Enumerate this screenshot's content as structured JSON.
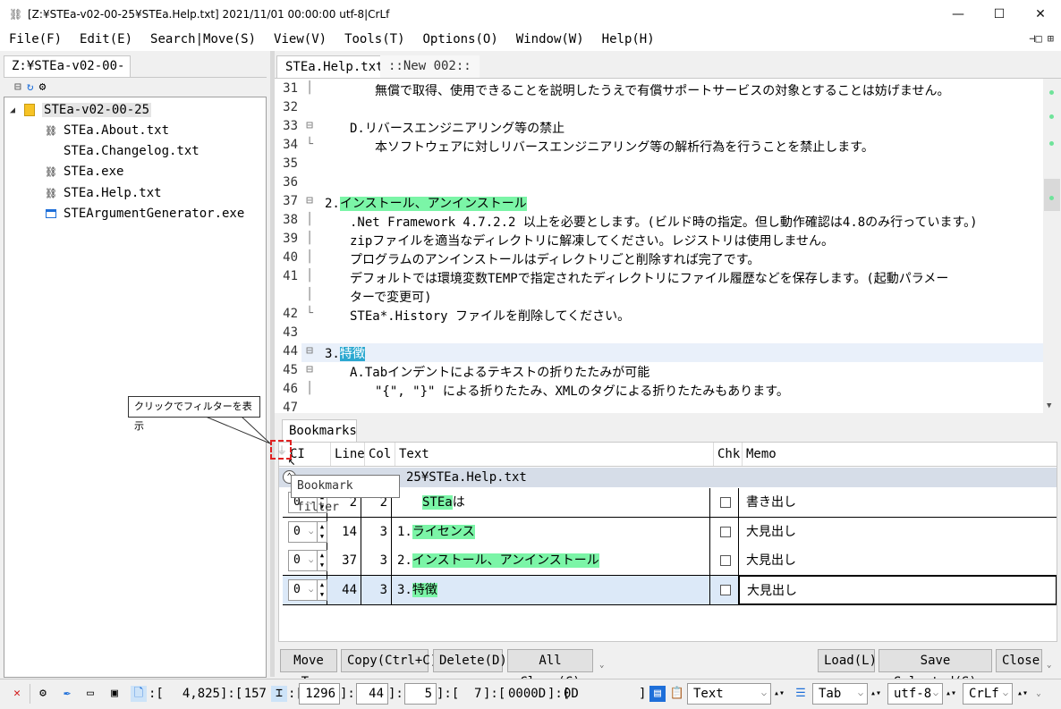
{
  "window": {
    "title": "[Z:¥STEa-v02-00-25¥STEa.Help.txt] 2021/11/01 00:00:00 utf-8|CrLf",
    "minimize": "—",
    "maximize": "☐",
    "close": "✕"
  },
  "menu": [
    {
      "label": "File(F)"
    },
    {
      "label": "Edit(E)"
    },
    {
      "label": "Search|Move(S)"
    },
    {
      "label": "View(V)"
    },
    {
      "label": "Tools(T)"
    },
    {
      "label": "Options(O)"
    },
    {
      "label": "Window(W)"
    },
    {
      "label": "Help(H)"
    }
  ],
  "explorer": {
    "tab": "Z:¥STEa-v02-00-25",
    "root": "STEa-v02-00-25",
    "files": [
      {
        "name": "STEa.About.txt",
        "icon": "stea-file-icon"
      },
      {
        "name": "STEa.Changelog.txt",
        "icon": "none"
      },
      {
        "name": "STEa.exe",
        "icon": "stea-file-icon"
      },
      {
        "name": "STEa.Help.txt",
        "icon": "stea-file-icon"
      },
      {
        "name": "STEArgumentGenerator.exe",
        "icon": "exe-window-icon"
      }
    ]
  },
  "editor": {
    "tabs": [
      "STEa.Help.txt",
      "::New 002::"
    ],
    "lines": [
      {
        "num": "31",
        "fold": "│",
        "pre": "　　　　",
        "hl": "",
        "post": "無償で取得、使用できることを説明したうえで有償サポートサービスの対象とすることは妨げません。",
        "style": ""
      },
      {
        "num": "32",
        "fold": "",
        "pre": "",
        "hl": "",
        "post": "",
        "style": ""
      },
      {
        "num": "33",
        "fold": "⊟",
        "pre": "　　",
        "hl": "",
        "post": "D.リバースエンジニアリング等の禁止",
        "style": ""
      },
      {
        "num": "34",
        "fold": "└",
        "pre": "　　　　",
        "hl": "",
        "post": "本ソフトウェアに対しリバースエンジニアリング等の解析行為を行うことを禁止します。",
        "style": ""
      },
      {
        "num": "35",
        "fold": "",
        "pre": "",
        "hl": "",
        "post": "",
        "style": ""
      },
      {
        "num": "36",
        "fold": "",
        "pre": "",
        "hl": "",
        "post": "",
        "style": ""
      },
      {
        "num": "37",
        "fold": "⊟",
        "pre": "2.",
        "hl": "インストール、アンインストール",
        "post": "",
        "style": "green"
      },
      {
        "num": "38",
        "fold": "│",
        "pre": "　　",
        "hl": "",
        "post": ".Net Framework 4.7.2.2 以上を必要とします。(ビルド時の指定。但し動作確認は4.8のみ行っています。)",
        "style": ""
      },
      {
        "num": "39",
        "fold": "│",
        "pre": "　　",
        "hl": "",
        "post": "zipファイルを適当なディレクトリに解凍してください。レジストリは使用しません。",
        "style": ""
      },
      {
        "num": "40",
        "fold": "│",
        "pre": "　　",
        "hl": "",
        "post": "プログラムのアンインストールはディレクトリごと削除すれば完了です。",
        "style": ""
      },
      {
        "num": "41",
        "fold": "│",
        "pre": "　　",
        "hl": "",
        "post": "デフォルトでは環境変数TEMPで指定されたディレクトリにファイル履歴などを保存します。(起動パラメー",
        "style": ""
      },
      {
        "num": "",
        "fold": "│",
        "pre": "　　",
        "hl": "",
        "post": "ターで変更可)",
        "style": ""
      },
      {
        "num": "42",
        "fold": "└",
        "pre": "　　",
        "hl": "",
        "post": "STEa*.History ファイルを削除してください。",
        "style": ""
      },
      {
        "num": "43",
        "fold": "",
        "pre": "",
        "hl": "",
        "post": "",
        "style": ""
      },
      {
        "num": "44",
        "fold": "⊟",
        "pre": "3.",
        "hl": "特徴",
        "post": "",
        "style": "teal"
      },
      {
        "num": "45",
        "fold": "⊟",
        "pre": "　　",
        "hl": "",
        "post": "A.Tabインデントによるテキストの折りたたみが可能",
        "style": ""
      },
      {
        "num": "46",
        "fold": "│",
        "pre": "　　　　",
        "hl": "",
        "post": "\"{\", \"}\" による折りたたみ、XMLのタグによる折りたたみもあります。",
        "style": ""
      },
      {
        "num": "47",
        "fold": "",
        "pre": "",
        "hl": "",
        "post": "",
        "style": ""
      }
    ]
  },
  "bookmarks": {
    "tab": "Bookmarks",
    "headers": {
      "cl": "CI",
      "line": "Line",
      "col": "Col",
      "text": "Text",
      "chk": "Chk",
      "memo": "Memo"
    },
    "group": "25¥STEa.Help.txt",
    "rows": [
      {
        "cl": "0",
        "line": "2",
        "col": "2",
        "prefix": "　　",
        "text": "STEaは",
        "hl": "STEa",
        "rest": "は",
        "memo": "書き出し",
        "selected": false
      },
      {
        "cl": "0",
        "line": "14",
        "col": "3",
        "prefix": "1.",
        "hl": "ライセンス",
        "rest": "",
        "memo": "大見出し",
        "selected": false
      },
      {
        "cl": "0",
        "line": "37",
        "col": "3",
        "prefix": "2.",
        "hl": "インストール、アンインストール",
        "rest": "",
        "memo": "大見出し",
        "selected": false
      },
      {
        "cl": "0",
        "line": "44",
        "col": "3",
        "prefix": "3.",
        "hl": "特徴",
        "rest": "",
        "memo": "大見出し",
        "selected": true
      }
    ],
    "buttons": {
      "move_to": "Move To",
      "copy": "Copy(Ctrl+C)",
      "delete": "Delete(D)",
      "all_clear": "All Clear(C)",
      "load": "Load(L)",
      "save_selected": "Save Selected(S)",
      "close": "Close"
    },
    "tooltip": "Bookmark filter",
    "callout": "クリックでフィルターを表示"
  },
  "status": {
    "pos_label": ":[",
    "chars": "4,825",
    "sep1": "]:[",
    "lines": "157",
    "sel_open": "]",
    "col_a": "1296",
    "col_b": "44",
    "col_c": "5",
    "col_d": "7",
    "hex": "0000D",
    "hex2": "0D",
    "mode": "Text",
    "indent": "Tab",
    "encoding": "utf-8",
    "newline": "CrLf"
  },
  "colors": {
    "highlight_green": "#7bf5a7",
    "highlight_teal": "#2ba8d0",
    "selected_row": "#dce9f8",
    "status_blue_icon": "#1e6fd9"
  }
}
